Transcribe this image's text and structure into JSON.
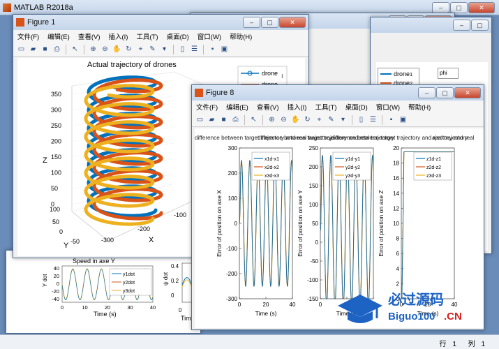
{
  "matlab": {
    "title": "MATLAB R2018a",
    "status_row_label": "行",
    "status_row": "1",
    "status_col_label": "列",
    "status_col": "1"
  },
  "menus": [
    "文件(F)",
    "编辑(E)",
    "查看(V)",
    "插入(I)",
    "工具(T)",
    "桌面(D)",
    "窗口(W)",
    "帮助(H)"
  ],
  "fig1": {
    "title": "Figure 1",
    "chart_title": "Actual trajectory of drones",
    "xlabel": "X",
    "ylabel": "Y",
    "zlabel": "Z",
    "z_ticks": [
      "350",
      "300",
      "250",
      "200",
      "150",
      "100",
      "50",
      "0"
    ],
    "x_ticks": [
      "-300",
      "-200",
      "-100"
    ],
    "y_ticks": [
      "100",
      "50",
      "0",
      "-50"
    ],
    "legend": [
      {
        "name": "drone",
        "sub": "1"
      },
      {
        "name": "drone",
        "sub": "2"
      }
    ]
  },
  "fig8": {
    "title": "Figure 8",
    "overlap_title": "difference between target trajectory and real trajectory",
    "overlap_title_right": "ajectory and real"
  },
  "bg_right_win": {
    "legend": [
      {
        "name": "drone",
        "sub": "1"
      },
      {
        "name": "drone",
        "sub": "2"
      }
    ],
    "phi_label": "phi"
  },
  "bg_bottom": {
    "title": "Speed in axe Y",
    "ylabel": "Y dot",
    "xlabel": "Time (s)",
    "y_ticks": [
      "40",
      "20",
      "0",
      "-20",
      "-40"
    ],
    "x_ticks": [
      "0",
      "10",
      "20",
      "30",
      "40"
    ],
    "legend": [
      "y1dot",
      "y2dot",
      "y3dot"
    ],
    "right_ticks": [
      "0.4",
      "0.2",
      "0"
    ],
    "right_ylabel": "ψ dot",
    "right_xlabel": "Time (s)",
    "right_x0": "0"
  },
  "chart_data": [
    {
      "type": "line",
      "title": "",
      "xlabel": "Time (s)",
      "ylabel": "Error of position on axe X",
      "ylim": [
        -300,
        300
      ],
      "xlim": [
        0,
        40
      ],
      "y_ticks": [
        300,
        200,
        100,
        0,
        -100,
        -200,
        -300
      ],
      "x_ticks": [
        0,
        20,
        40
      ],
      "series": [
        {
          "name": "x1d-x1",
          "color": "#0072bd"
        },
        {
          "name": "x2d-x2",
          "color": "#d95319"
        },
        {
          "name": "x3d-x3",
          "color": "#edb120"
        }
      ],
      "amplitude": 250,
      "period": 6.3
    },
    {
      "type": "line",
      "title": "",
      "xlabel": "Time (s)",
      "ylabel": "Error of position on axe Y",
      "ylim": [
        -150,
        250
      ],
      "xlim": [
        0,
        40
      ],
      "y_ticks": [
        250,
        200,
        150,
        100,
        50,
        0,
        -50,
        -100,
        -150
      ],
      "x_ticks": [
        0,
        20,
        40
      ],
      "series": [
        {
          "name": "y1d-y1",
          "color": "#0072bd"
        },
        {
          "name": "y2d-y2",
          "color": "#d95319"
        },
        {
          "name": "y3d-y3",
          "color": "#edb120"
        }
      ],
      "amplitude": 200,
      "period": 6.3
    },
    {
      "type": "line",
      "title": "",
      "xlabel": "Time (s)",
      "ylabel": "Error of position on axe Z",
      "ylim": [
        0,
        20
      ],
      "xlim": [
        0,
        40
      ],
      "y_ticks": [
        20,
        18,
        16,
        14,
        12,
        10,
        8,
        6,
        4,
        2,
        0
      ],
      "x_ticks": [
        0,
        20,
        40
      ],
      "series": [
        {
          "name": "z1d-z1",
          "color": "#0072bd"
        },
        {
          "name": "z2d-z2",
          "color": "#d95319"
        },
        {
          "name": "z3d-z3",
          "color": "#edb120"
        }
      ],
      "step_value": 19.5
    }
  ],
  "watermark": {
    "main": "必过源码",
    "url": "Biguo100",
    "tld": ".CN"
  },
  "colors": {
    "blue": "#0072bd",
    "orange": "#d95319",
    "yellow": "#edb120"
  }
}
